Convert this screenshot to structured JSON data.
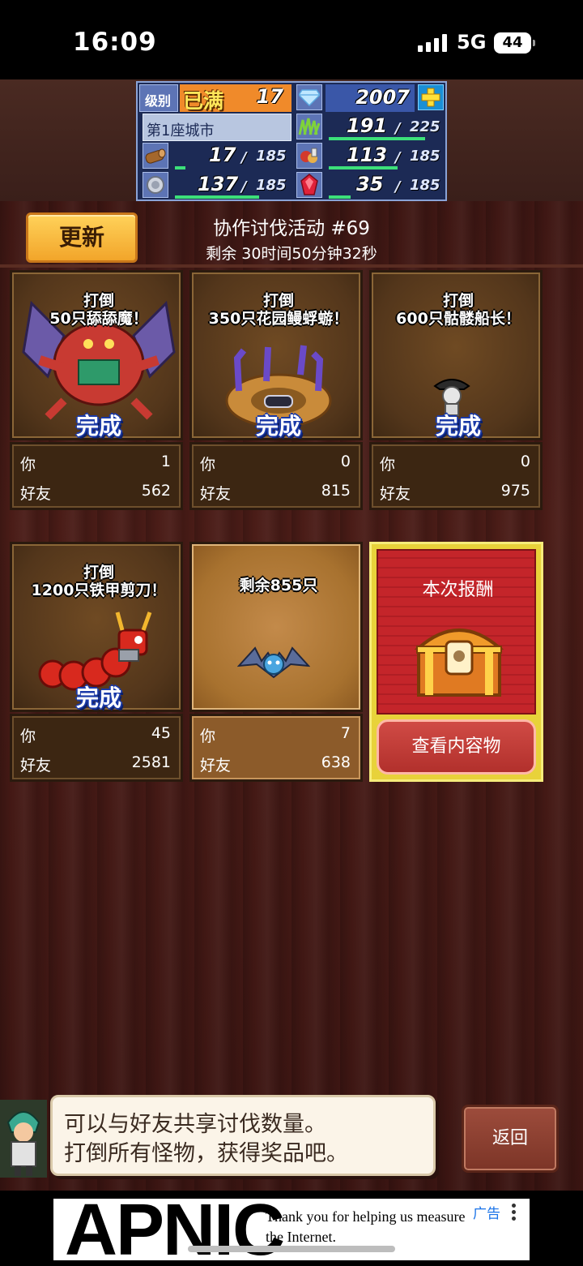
{
  "status_bar": {
    "time": "16:09",
    "network": "5G",
    "battery": "44"
  },
  "resources": {
    "level_label": "级别",
    "level_status": "已满",
    "level_value": "17",
    "gems": "2007",
    "city_name": "第1座城市",
    "grass": {
      "value": "191",
      "max": "225",
      "fill": 0.85
    },
    "wood": {
      "value": "17",
      "max": "185",
      "fill": 0.09
    },
    "food": {
      "value": "113",
      "max": "185",
      "fill": 0.61
    },
    "ore": {
      "value": "137",
      "max": "185",
      "fill": 0.74
    },
    "ruby": {
      "value": "35",
      "max": "185",
      "fill": 0.19
    },
    "max_separator": "/"
  },
  "header": {
    "refresh_label": "更新",
    "title": "协作讨伐活动 #69",
    "remaining": "剩余 30时间50分钟32秒"
  },
  "cards": [
    {
      "title_line1": "打倒",
      "title_line2": "50只舔舔魔！",
      "status": "完成",
      "you_label": "你",
      "you_value": "1",
      "friends_label": "好友",
      "friends_value": "562",
      "monster": "demon"
    },
    {
      "title_line1": "打倒",
      "title_line2": "350只花园鳗蜉蝣！",
      "status": "完成",
      "you_label": "你",
      "you_value": "0",
      "friends_label": "好友",
      "friends_value": "815",
      "monster": "garden-eel"
    },
    {
      "title_line1": "打倒",
      "title_line2": "600只骷髅船长！",
      "status": "完成",
      "you_label": "你",
      "you_value": "0",
      "friends_label": "好友",
      "friends_value": "975",
      "monster": "skeleton-captain"
    },
    {
      "title_line1": "打倒",
      "title_line2": "1200只铁甲剪刀！",
      "status": "完成",
      "you_label": "你",
      "you_value": "45",
      "friends_label": "好友",
      "friends_value": "2581",
      "monster": "iron-centipede"
    },
    {
      "title_line1": "剩余855只",
      "title_line2": "",
      "status": "",
      "you_label": "你",
      "you_value": "7",
      "friends_label": "好友",
      "friends_value": "638",
      "monster": "bat"
    }
  ],
  "reward": {
    "title": "本次报酬",
    "button_label": "查看内容物"
  },
  "message": {
    "line1": "可以与好友共享讨伐数量。",
    "line2": "打倒所有怪物，获得奖品吧。"
  },
  "back_label": "返回",
  "ad": {
    "logo": "APNIC",
    "text": "Thank you for helping us measure the Internet.",
    "label": "广告"
  },
  "colors": {
    "complete_text": "#1b3aa8",
    "progress_bar": "#3ce07a",
    "reward_red": "#c4252a"
  }
}
